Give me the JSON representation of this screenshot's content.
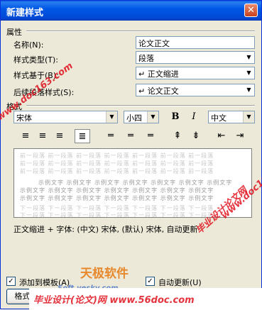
{
  "title": "新建样式",
  "close_glyph": "✕",
  "properties": {
    "group_label": "属性",
    "name_label": "名称(N):",
    "name_value": "论文正文",
    "type_label": "样式类型(T):",
    "type_value": "段落",
    "based_on_label": "样式基于(B):",
    "based_on_value": "正文缩进",
    "next_label": "后续段落样式(S):",
    "next_value": "论文正文",
    "para_mark": "↵"
  },
  "format": {
    "group_label": "格式",
    "font": "宋体",
    "size": "小四",
    "bold": "B",
    "italic": "I",
    "lang": "中文"
  },
  "preview_text": {
    "prev": "前一段落 前一段落 前一段落 前一段落 前一段落 前一段落 前一段落",
    "sample": "示例文字 示例文字 示例文字 示例文字 示例文字 示例文字 示例文字",
    "next": "下一段落 下一段落 下一段落 下一段落 下一段落 下一段落 下一段落"
  },
  "description": "正文缩进 + 字体: (中文) 宋体, (默认) 宋体, 自动更新",
  "add_to_template_label": "添加到模板(A)",
  "auto_update_label": "自动更新(U)",
  "format_button_label": "格式(O)",
  "ok_label": "确定",
  "cancel_label": "取消",
  "watermarks": {
    "left": "www.doc163.com",
    "right_cn": "毕业设计论文网",
    "right_url": "www.doc163.com",
    "logo_cn": "天极软件",
    "logo_url": "Soft.yesky.com",
    "bottom": "毕业设计(论文)网 www.56doc.com"
  },
  "colors": {
    "accent": "#0054e3",
    "watermark": "#e0101b"
  }
}
